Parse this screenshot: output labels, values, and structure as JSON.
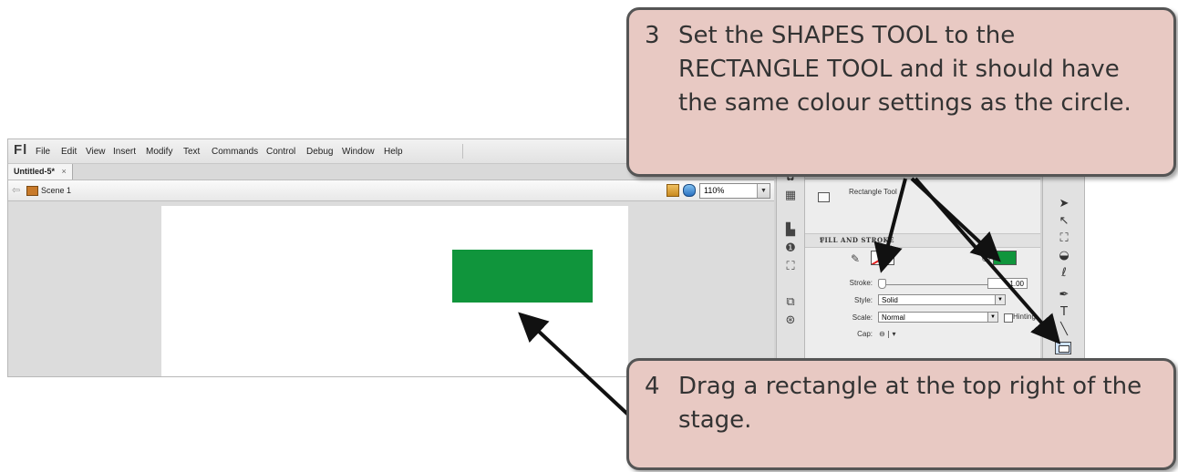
{
  "app": {
    "logo": "Fl",
    "menu": [
      "File",
      "Edit",
      "View",
      "Insert",
      "Modify",
      "Text",
      "Commands",
      "Control",
      "Debug",
      "Window",
      "Help"
    ],
    "document_tab": "Untitled-5*",
    "tab_close": "×",
    "scene_label": "Scene 1",
    "zoom": "110%",
    "dropdown_glyph": "▼"
  },
  "properties": {
    "tool_name": "Rectangle Tool",
    "section_header": "FILL AND STROKE",
    "stroke_label": "Stroke:",
    "stroke_value": "1.00",
    "style_label": "Style:",
    "style_value": "Solid",
    "scale_label": "Scale:",
    "scale_value": "Normal",
    "hinting_label": "Hinting",
    "cap_label": "Cap:",
    "cap_value": "⊖ | ▾",
    "stroke_color": "#e02020",
    "fill_color": "#10953c"
  },
  "stage": {
    "rectangle_color": "#10953c"
  },
  "callouts": {
    "step3": {
      "number": "3",
      "text": "Set the SHAPES TOOL to the RECTANGLE TOOL and it should have the same colour settings as the circle."
    },
    "step4": {
      "number": "4",
      "text": "Drag a rectangle at the top right of the stage."
    },
    "background_color": "#e8c9c3"
  }
}
